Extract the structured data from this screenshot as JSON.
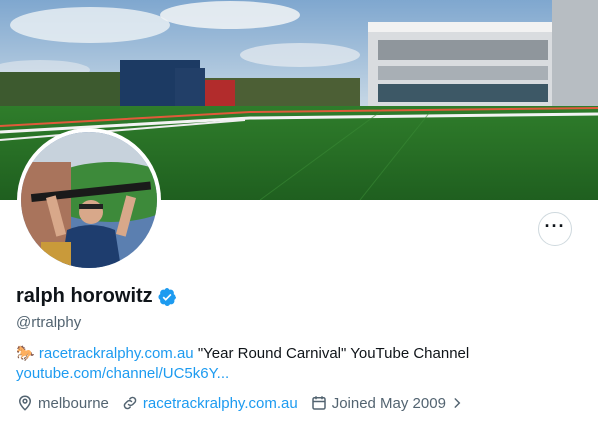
{
  "profile": {
    "display_name": "ralph horowitz",
    "handle": "@rtralphy",
    "bio": {
      "emoji": "🐎",
      "link_text": "racetrackralphy.com.au",
      "text": " \"Year Round Carnival\"  YouTube Channel",
      "link2_text": "youtube.com/channel/UC5k6Y..."
    },
    "location": "melbourne",
    "website": "racetrackralphy.com.au",
    "joined": "Joined May 2009"
  },
  "icons": {
    "more": "more-icon",
    "verified": "verified-badge-icon",
    "location": "location-pin-icon",
    "link": "link-icon",
    "calendar": "calendar-icon",
    "chevron": "chevron-right-icon"
  },
  "colors": {
    "accent": "#1d9bf0",
    "text": "#0f1419",
    "secondary": "#536471"
  }
}
